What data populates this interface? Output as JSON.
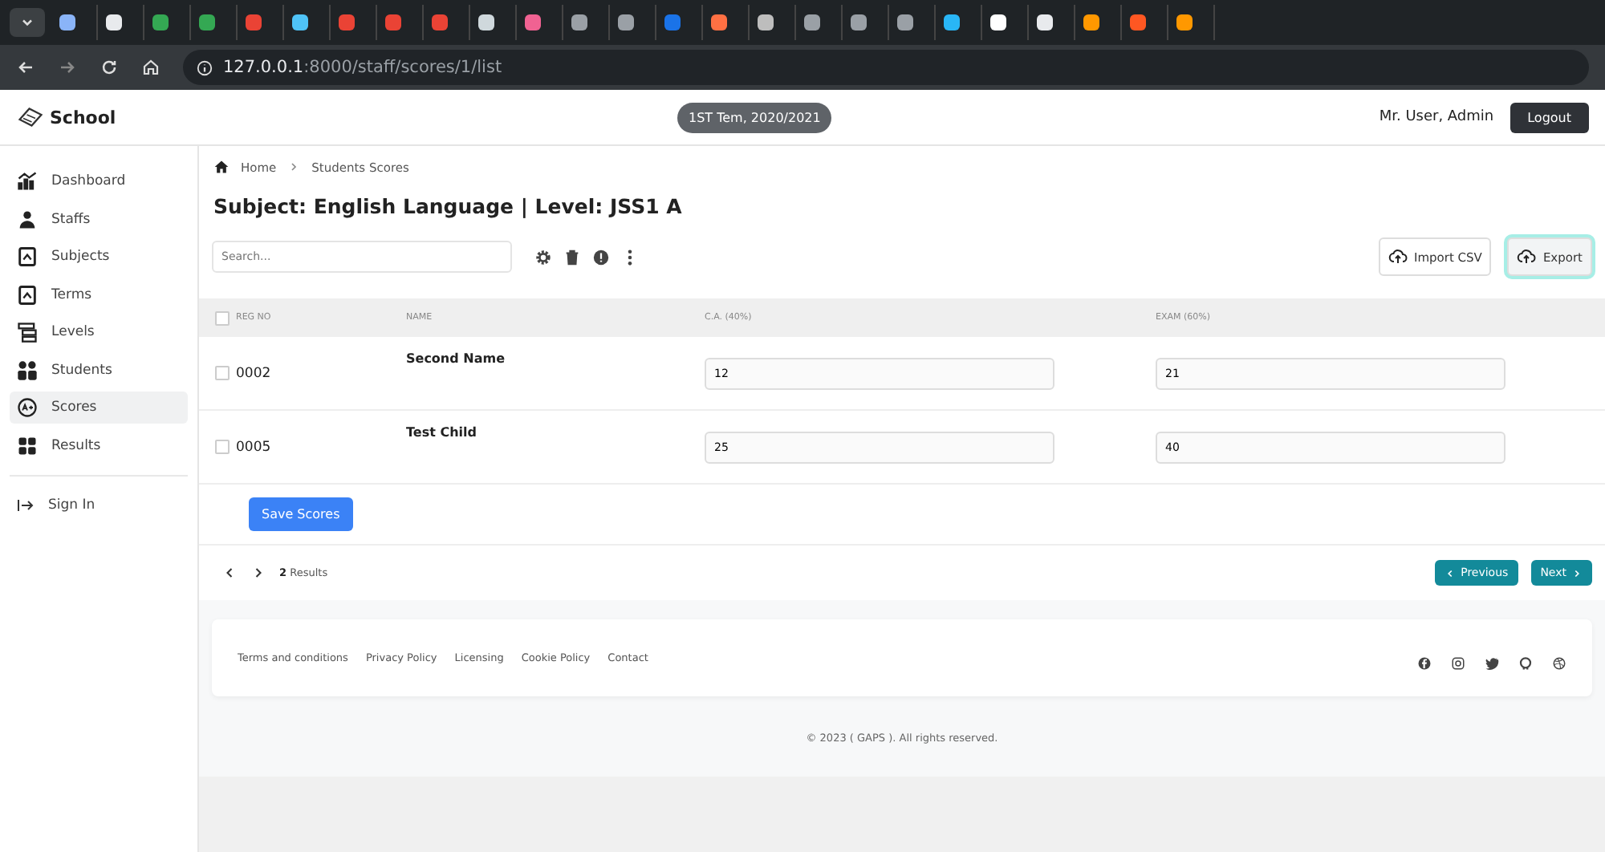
{
  "browser": {
    "tabs": [
      {
        "color": "#8ab4f8"
      },
      {
        "color": "#e8eaed"
      },
      {
        "color": "#34a853"
      },
      {
        "color": "#34a853"
      },
      {
        "color": "#ea4335"
      },
      {
        "color": "#4fc3f7"
      },
      {
        "color": "#ea4335"
      },
      {
        "color": "#ea4335"
      },
      {
        "color": "#ea4335"
      },
      {
        "color": "#cfd8dc"
      },
      {
        "color": "#f06292"
      },
      {
        "color": "#9aa0a6"
      },
      {
        "color": "#9aa0a6"
      },
      {
        "color": "#1a73e8"
      },
      {
        "color": "#ff7043"
      },
      {
        "color": "#bdbdbd"
      },
      {
        "color": "#9aa0a6"
      },
      {
        "color": "#9aa0a6"
      },
      {
        "color": "#9aa0a6"
      },
      {
        "color": "#29b6f6"
      },
      {
        "color": "#ffffff"
      },
      {
        "color": "#e8eaed"
      },
      {
        "color": "#ff9800"
      },
      {
        "color": "#ff5722"
      },
      {
        "color": "#ff9800"
      }
    ],
    "url_host": "127.0.0.1",
    "url_path": ":8000/staff/scores/1/list"
  },
  "header": {
    "brand": "School",
    "term": "1ST Tem, 2020/2021",
    "user": "Mr. User, Admin",
    "logout": "Logout"
  },
  "sidebar": {
    "items": [
      {
        "label": "Dashboard",
        "kind": "chart",
        "selected": false
      },
      {
        "label": "Staffs",
        "kind": "person",
        "selected": false
      },
      {
        "label": "Subjects",
        "kind": "book",
        "selected": false
      },
      {
        "label": "Terms",
        "kind": "book",
        "selected": false
      },
      {
        "label": "Levels",
        "kind": "levels",
        "selected": false
      },
      {
        "label": "Students",
        "kind": "people",
        "selected": false
      },
      {
        "label": "Scores",
        "kind": "grade",
        "selected": true
      },
      {
        "label": "Results",
        "kind": "grid",
        "selected": false
      }
    ],
    "signin": "Sign In"
  },
  "breadcrumb": [
    "Home",
    "Students Scores"
  ],
  "title": "Subject: English Language | Level: JSS1 A",
  "search": {
    "placeholder": "Search..."
  },
  "actions": [
    {
      "label": "Import CSV",
      "focused": false
    },
    {
      "label": "Export",
      "focused": true
    }
  ],
  "table": {
    "select_all": {
      "checked": false
    },
    "columns": [
      "REG NO",
      "NAME",
      "C.A. (40%)",
      "EXAM (60%)"
    ],
    "rows": [
      {
        "checked": false,
        "reg": "0002",
        "name": "Second Name",
        "ca": "12",
        "exam": "21"
      },
      {
        "checked": false,
        "reg": "0005",
        "name": "Test Child",
        "ca": "25",
        "exam": "40"
      }
    ]
  },
  "save": "Save Scores",
  "pagination": {
    "count": "2",
    "results": "Results",
    "previous": "Previous",
    "next": "Next"
  },
  "footer": {
    "links": [
      "Terms and conditions",
      "Privacy Policy",
      "Licensing",
      "Cookie Policy",
      "Contact"
    ],
    "copyright": "© 2023 ( GAPS ). All rights reserved."
  }
}
